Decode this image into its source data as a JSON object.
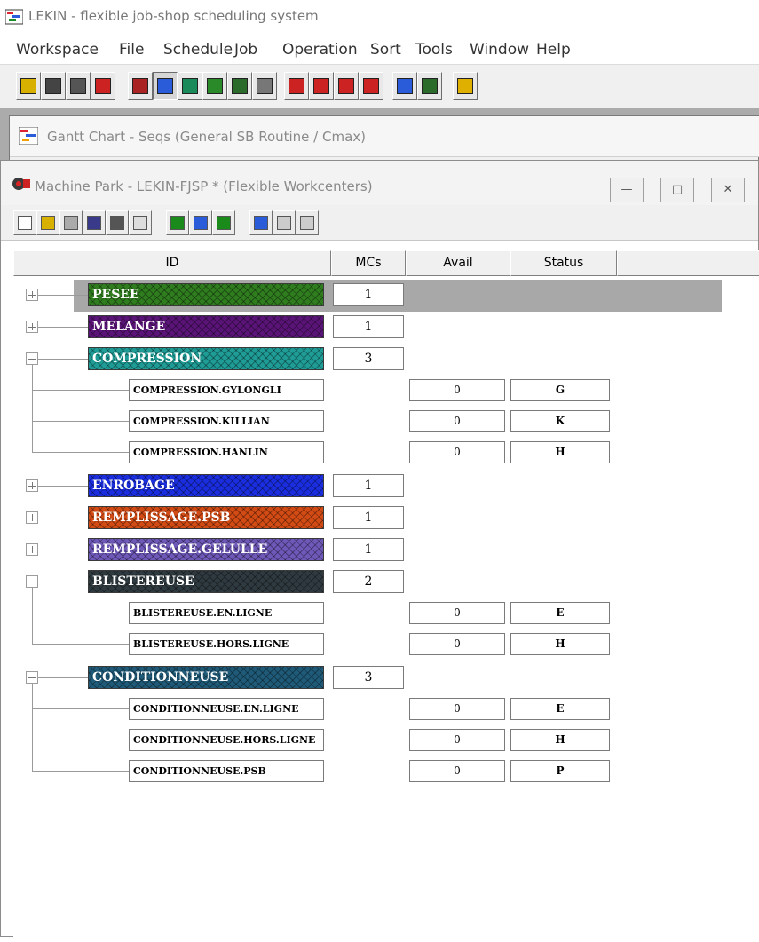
{
  "app": {
    "title": "LEKIN - flexible job-shop scheduling system"
  },
  "menu": [
    "Workspace",
    "File",
    "Schedule",
    "Job",
    "Operation",
    "Sort",
    "Tools",
    "Window",
    "Help"
  ],
  "gantt_window": {
    "title": "Gantt Chart - Seqs (General SB Routine / Cmax)"
  },
  "machine_park": {
    "title": "Machine Park - LEKIN-FJSP * (Flexible Workcenters)",
    "columns": [
      "ID",
      "MCs",
      "Avail",
      "Status"
    ],
    "workcenters": [
      {
        "id": "PESEE",
        "mcs": "1",
        "color": "#2f7d1f",
        "expanded": false,
        "selected": true,
        "machines": []
      },
      {
        "id": "MELANGE",
        "mcs": "1",
        "color": "#5a1478",
        "expanded": false,
        "machines": []
      },
      {
        "id": "COMPRESSION",
        "mcs": "3",
        "color": "#1f9c96",
        "expanded": true,
        "machines": [
          {
            "id": "COMPRESSION.GYLONGLI",
            "avail": "0",
            "status": "G"
          },
          {
            "id": "COMPRESSION.KILLIAN",
            "avail": "0",
            "status": "K"
          },
          {
            "id": "COMPRESSION.HANLIN",
            "avail": "0",
            "status": "H"
          }
        ]
      },
      {
        "id": "ENROBAGE",
        "mcs": "1",
        "color": "#1a2ee0",
        "expanded": false,
        "machines": []
      },
      {
        "id": "REMPLISSAGE.PSB",
        "mcs": "1",
        "color": "#d24a14",
        "expanded": false,
        "machines": []
      },
      {
        "id": "REMPLISSAGE.GELULLE",
        "mcs": "1",
        "color": "#6e58b8",
        "expanded": false,
        "machines": []
      },
      {
        "id": "BLISTEREUSE",
        "mcs": "2",
        "color": "#2f3a40",
        "expanded": true,
        "machines": [
          {
            "id": "BLISTEREUSE.EN.LIGNE",
            "avail": "0",
            "status": "E"
          },
          {
            "id": "BLISTEREUSE.HORS.LIGNE",
            "avail": "0",
            "status": "H"
          }
        ]
      },
      {
        "id": "CONDITIONNEUSE",
        "mcs": "3",
        "color": "#1f5a78",
        "expanded": true,
        "machines": [
          {
            "id": "CONDITIONNEUSE.EN.LIGNE",
            "avail": "0",
            "status": "E"
          },
          {
            "id": "CONDITIONNEUSE.HORS.LIGNE",
            "avail": "0",
            "status": "H"
          },
          {
            "id": "CONDITIONNEUSE.PSB",
            "avail": "0",
            "status": "P"
          }
        ]
      }
    ]
  }
}
